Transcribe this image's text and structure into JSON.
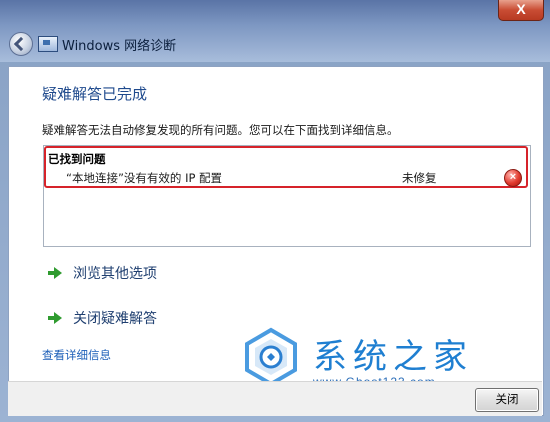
{
  "window": {
    "title": "Windows 网络诊断",
    "close_glyph": "X"
  },
  "main": {
    "heading": "疑难解答已完成",
    "description": "疑难解答无法自动修复发现的所有问题。您可以在下面找到详细信息。",
    "found_title": "已找到问题",
    "issues": [
      {
        "text": "“本地连接”没有有效的 IP 配置",
        "status": "未修复",
        "icon": "error-icon"
      }
    ],
    "options": [
      {
        "label": "浏览其他选项",
        "icon": "green-arrow-icon"
      },
      {
        "label": "关闭疑难解答",
        "icon": "green-arrow-icon"
      }
    ],
    "details_link": "查看详细信息"
  },
  "watermark": {
    "name": "系统之家",
    "url": "www.Ghost123.com"
  },
  "footer": {
    "close_label": "关闭"
  },
  "colors": {
    "heading": "#1f4a8d",
    "highlight_border": "#d6232a",
    "link": "#1d5fb8",
    "arrow": "#2f9b2f"
  }
}
